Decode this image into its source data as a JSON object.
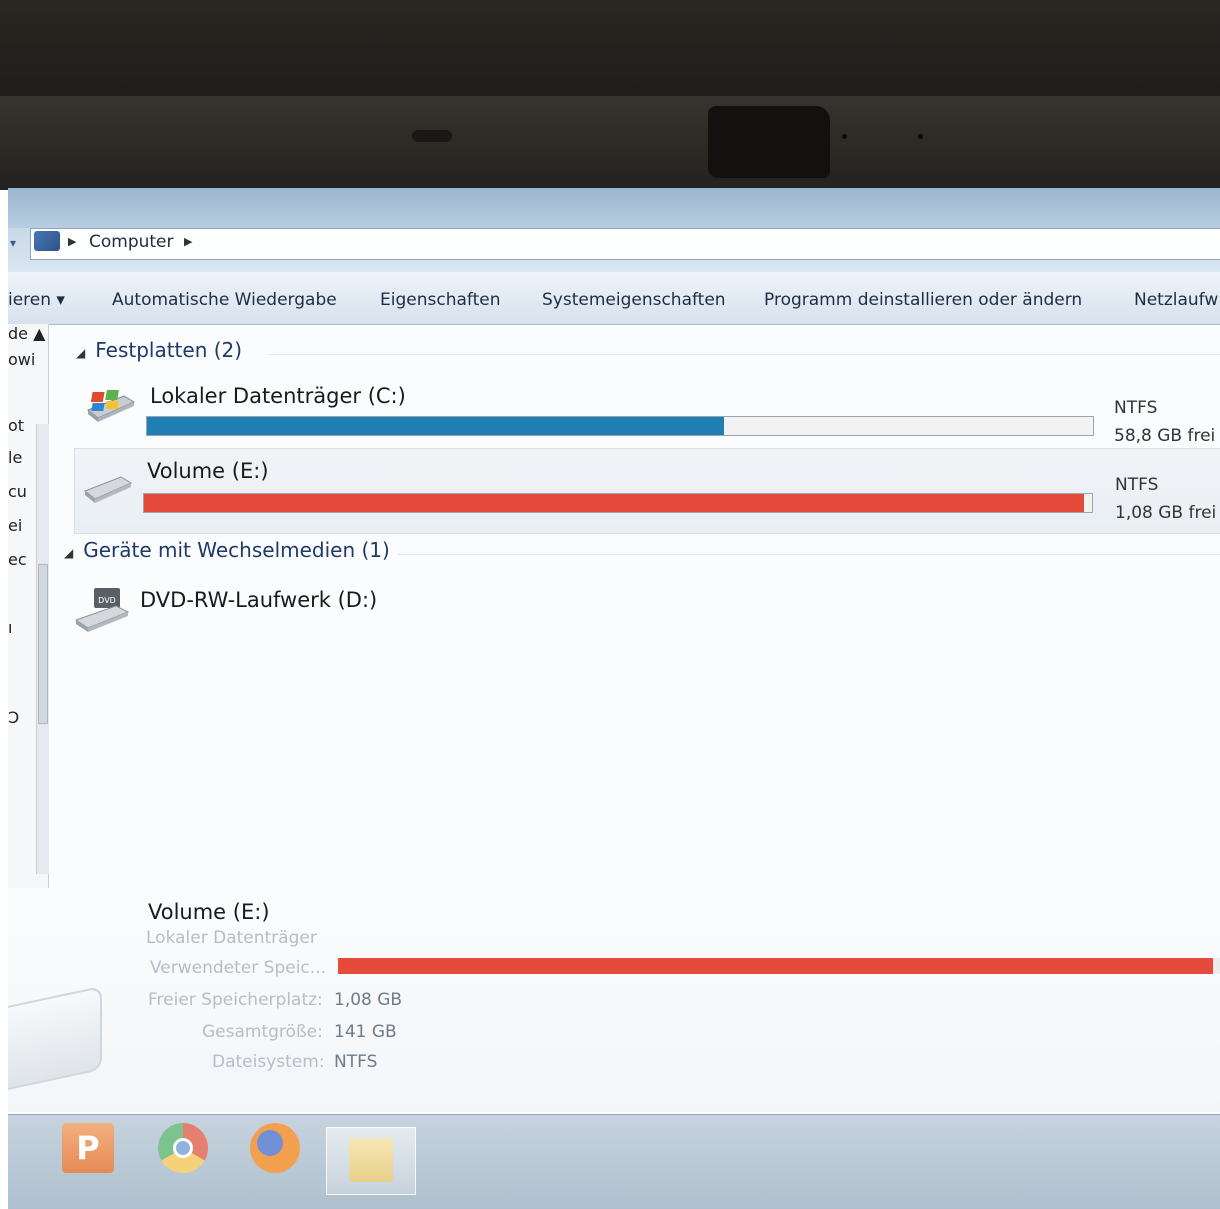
{
  "window": {
    "breadcrumb": [
      "Computer"
    ]
  },
  "toolbar": {
    "items": [
      "ieren ▾",
      "Automatische Wiedergabe",
      "Eigenschaften",
      "Systemeigenschaften",
      "Programm deinstallieren oder ändern",
      "Netzlaufw"
    ]
  },
  "navpane": {
    "fragments": [
      "de ▲",
      "owi",
      "ot",
      "le",
      "cu",
      "ei",
      "ec",
      "≡",
      "ı",
      "Ↄ"
    ]
  },
  "groups": {
    "hard_disks": {
      "title": "Festplatten (2)",
      "drives": [
        {
          "name": "Lokaler Datenträger (C:)",
          "fs": "NTFS",
          "free": "58,8 GB frei",
          "used_fraction": 0.61,
          "bar_color": "#1f7fb3"
        },
        {
          "name": "Volume (E:)",
          "fs": "NTFS",
          "free": "1,08 GB frei",
          "used_fraction": 0.992,
          "bar_color": "#e64a3a"
        }
      ]
    },
    "removable": {
      "title": "Geräte mit Wechselmedien (1)",
      "drives": [
        {
          "name": "DVD-RW-Laufwerk (D:)",
          "icon_label": "DVD"
        }
      ]
    }
  },
  "details": {
    "title": "Volume (E:)",
    "type": "Lokaler Datenträger",
    "used_label": "Verwendeter Speic...",
    "used_fraction": 0.992,
    "bar_color": "#e64a3a",
    "free_label": "Freier Speicherplatz:",
    "free_value": "1,08 GB",
    "total_label": "Gesamtgröße:",
    "total_value": "141 GB",
    "fs_label": "Dateisystem:",
    "fs_value": "NTFS"
  },
  "taskbar": {
    "apps": [
      {
        "name": "PowerPoint",
        "icon": "powerpoint-icon",
        "glyph": "P"
      },
      {
        "name": "Chrome",
        "icon": "chrome-icon"
      },
      {
        "name": "Firefox",
        "icon": "firefox-icon"
      },
      {
        "name": "Windows Explorer",
        "icon": "explorer-icon",
        "active": true
      }
    ]
  }
}
